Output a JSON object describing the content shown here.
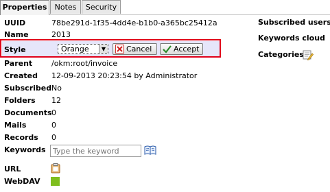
{
  "tabs": [
    {
      "label": "Properties"
    },
    {
      "label": "Notes"
    },
    {
      "label": "Security"
    }
  ],
  "properties": {
    "uuid": {
      "label": "UUID",
      "value": "78be291d-1f35-4dd4e-b1b0-a365bc25412a"
    },
    "name": {
      "label": "Name",
      "value": "2013"
    },
    "style": {
      "label": "Style",
      "selected": "Orange",
      "cancel_label": "Cancel",
      "accept_label": "Accept"
    },
    "parent": {
      "label": "Parent",
      "value": "/okm:root/invoice"
    },
    "created": {
      "label": "Created",
      "value": "12-09-2013 20:23:54 by Administrator"
    },
    "subscribed": {
      "label": "Subscribed",
      "value": "No"
    },
    "folders": {
      "label": "Folders",
      "value": "12"
    },
    "documents": {
      "label": "Documents",
      "value": "0"
    },
    "mails": {
      "label": "Mails",
      "value": "0"
    },
    "records": {
      "label": "Records",
      "value": "0"
    },
    "keywords": {
      "label": "Keywords",
      "placeholder": "Type the keyword"
    },
    "url": {
      "label": "URL"
    },
    "webdav": {
      "label": "WebDAV"
    }
  },
  "sidebar": {
    "subscribed_users": "Subscribed users",
    "keywords_cloud": "Keywords cloud",
    "categories": "Categories"
  },
  "colors": {
    "highlight_band": "#e6e6fa",
    "highlight_outline": "#e0001a",
    "webdav_square": "#7fbe1e",
    "url_icon": "#c47a1e"
  },
  "icons": {
    "select_arrow": "chevron-down-icon",
    "cancel": "x-icon",
    "accept": "checkmark-icon",
    "keyword_dictionary": "book-icon",
    "categories": "folder-edit-icon",
    "url": "clipboard-icon",
    "webdav": "green-square-icon"
  }
}
